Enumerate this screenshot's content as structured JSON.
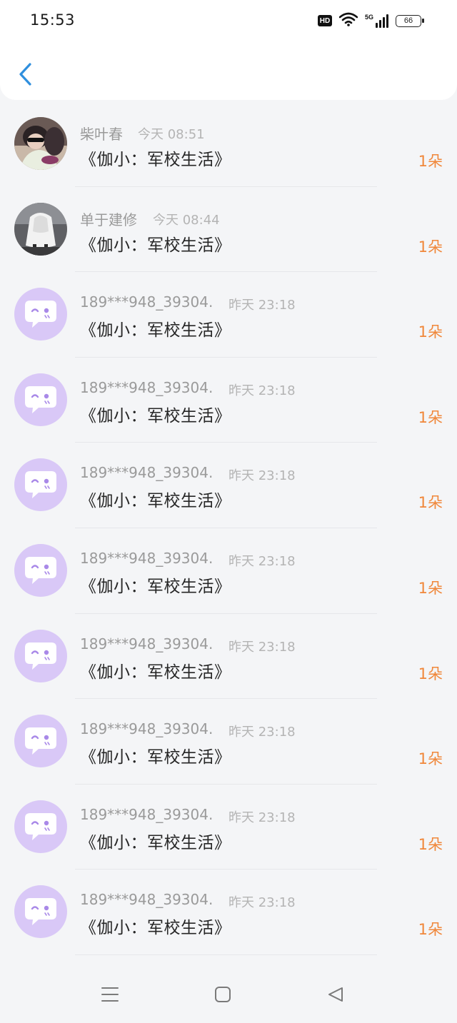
{
  "status_bar": {
    "time": "15:53",
    "hd": "HD",
    "network": "5G",
    "battery": "66"
  },
  "header": {
    "back_icon": "chevron-left-icon",
    "accent_color": "#2f8fde"
  },
  "items": [
    {
      "name": "柴叶春",
      "time": "今天 08:51",
      "title": "《伽小：军校生活》",
      "gift": "1朵",
      "avatar": "photo-1"
    },
    {
      "name": "单于建修",
      "time": "今天 08:44",
      "title": "《伽小：军校生活》",
      "gift": "1朵",
      "avatar": "photo-2"
    },
    {
      "name": "189***948_39304...",
      "time": "昨天 23:18",
      "title": "《伽小：军校生活》",
      "gift": "1朵",
      "avatar": "default-chat-bubble-icon"
    },
    {
      "name": "189***948_39304...",
      "time": "昨天 23:18",
      "title": "《伽小：军校生活》",
      "gift": "1朵",
      "avatar": "default-chat-bubble-icon"
    },
    {
      "name": "189***948_39304...",
      "time": "昨天 23:18",
      "title": "《伽小：军校生活》",
      "gift": "1朵",
      "avatar": "default-chat-bubble-icon"
    },
    {
      "name": "189***948_39304...",
      "time": "昨天 23:18",
      "title": "《伽小：军校生活》",
      "gift": "1朵",
      "avatar": "default-chat-bubble-icon"
    },
    {
      "name": "189***948_39304...",
      "time": "昨天 23:18",
      "title": "《伽小：军校生活》",
      "gift": "1朵",
      "avatar": "default-chat-bubble-icon"
    },
    {
      "name": "189***948_39304...",
      "time": "昨天 23:18",
      "title": "《伽小：军校生活》",
      "gift": "1朵",
      "avatar": "default-chat-bubble-icon"
    },
    {
      "name": "189***948_39304...",
      "time": "昨天 23:18",
      "title": "《伽小：军校生活》",
      "gift": "1朵",
      "avatar": "default-chat-bubble-icon"
    },
    {
      "name": "189***948_39304...",
      "time": "昨天 23:18",
      "title": "《伽小：军校生活》",
      "gift": "1朵",
      "avatar": "default-chat-bubble-icon"
    }
  ],
  "nav_bar": {
    "menu_icon": "menu-icon",
    "home_icon": "home-square-icon",
    "back_icon": "back-triangle-icon"
  },
  "colors": {
    "gift": "#f0873a",
    "avatar_default_bg": "#d9c8f7",
    "avatar_default_fg": "#a989e8"
  }
}
